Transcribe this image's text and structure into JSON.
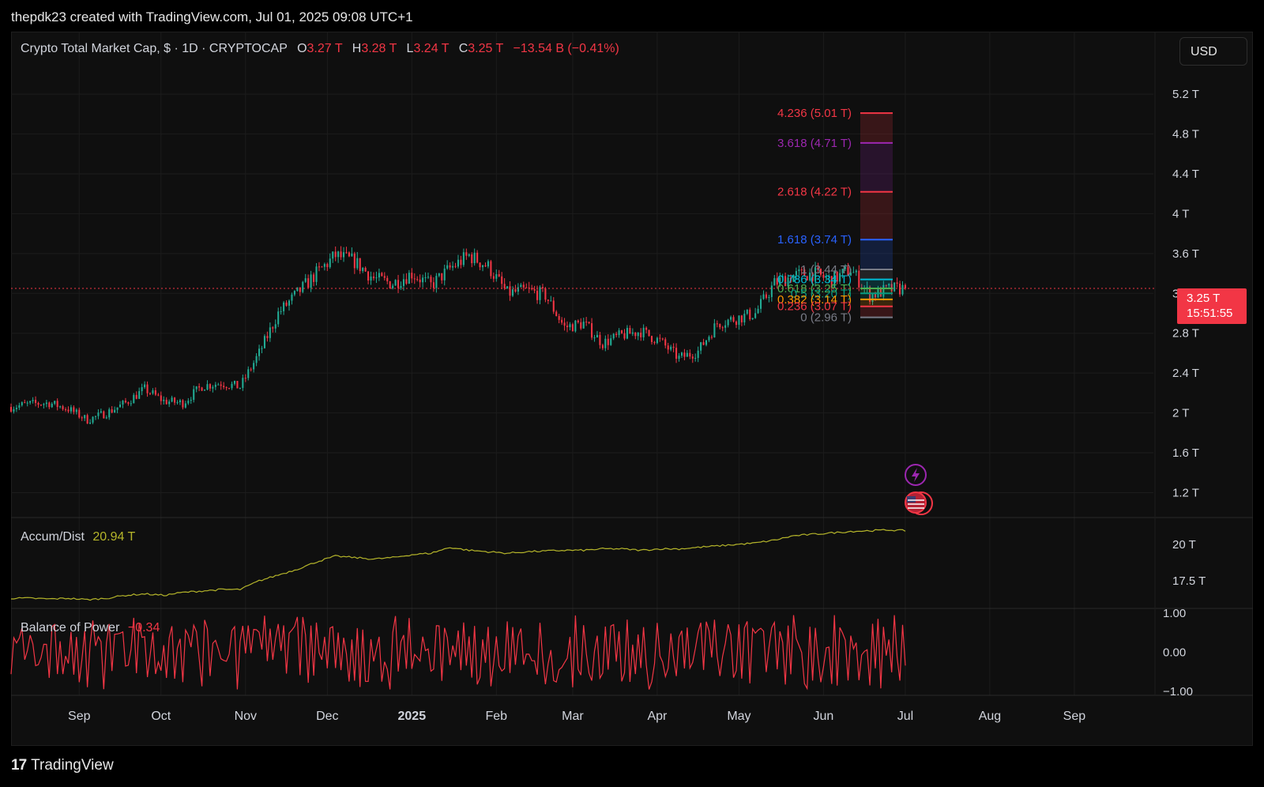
{
  "header": {
    "creator_line": "thepdk23 created with TradingView.com, Jul 01, 2025 09:08 UTC+1"
  },
  "toolbar": {
    "currency_button": "USD"
  },
  "symbol_legend": {
    "name": "Crypto Total Market Cap, $ · 1D · CRYPTOCAP",
    "open_key": "O",
    "open": "3.27 T",
    "high_key": "H",
    "high": "3.28 T",
    "low_key": "L",
    "low": "3.24 T",
    "close_key": "C",
    "close": "3.25 T",
    "change": "−13.54 B (−0.41%)"
  },
  "last_price": {
    "value": "3.25 T",
    "countdown": "15:51:55"
  },
  "indicators": {
    "ad_name": "Accum/Dist",
    "ad_value": "20.94 T",
    "bop_name": "Balance of Power",
    "bop_value": "−0.34"
  },
  "brand": {
    "logo": "17",
    "name": "TradingView"
  },
  "colors": {
    "up": "#22ab94",
    "down": "#f23645",
    "ad_line": "#b5b52a",
    "bop_line": "#f23645",
    "background": "#0f0f0f",
    "grid": "#1c1c1c"
  },
  "chart_data": {
    "type": "candlestick",
    "timeframe": "1D",
    "symbol": "CRYPTOCAP:TOTAL",
    "x_ticks": [
      "Sep",
      "Oct",
      "Nov",
      "Dec",
      "2025",
      "Feb",
      "Mar",
      "Apr",
      "May",
      "Jun",
      "Jul",
      "Aug",
      "Sep"
    ],
    "y_ticks": [
      "5.2 T",
      "4.8 T",
      "4.4 T",
      "4 T",
      "3.6 T",
      "3.2 T",
      "2.8 T",
      "2.4 T",
      "2 T",
      "1.6 T",
      "1.2 T"
    ],
    "y_tick_values": [
      5.2,
      4.8,
      4.4,
      4.0,
      3.6,
      3.2,
      2.8,
      2.4,
      2.0,
      1.6,
      1.2
    ],
    "ylim": [
      0.95,
      5.55
    ],
    "x_range": [
      "2024-08-07",
      "2025-09-30"
    ],
    "price_closes_weekly": [
      {
        "date": "2024-08-07",
        "close": 2.06
      },
      {
        "date": "2024-08-14",
        "close": 2.09
      },
      {
        "date": "2024-08-21",
        "close": 2.1
      },
      {
        "date": "2024-08-28",
        "close": 2.04
      },
      {
        "date": "2024-09-04",
        "close": 1.93
      },
      {
        "date": "2024-09-11",
        "close": 2.0
      },
      {
        "date": "2024-09-18",
        "close": 2.1
      },
      {
        "date": "2024-09-25",
        "close": 2.24
      },
      {
        "date": "2024-10-02",
        "close": 2.12
      },
      {
        "date": "2024-10-09",
        "close": 2.1
      },
      {
        "date": "2024-10-16",
        "close": 2.27
      },
      {
        "date": "2024-10-23",
        "close": 2.3
      },
      {
        "date": "2024-10-30",
        "close": 2.26
      },
      {
        "date": "2024-11-06",
        "close": 2.6
      },
      {
        "date": "2024-11-13",
        "close": 3.0
      },
      {
        "date": "2024-11-20",
        "close": 3.2
      },
      {
        "date": "2024-11-27",
        "close": 3.4
      },
      {
        "date": "2024-12-04",
        "close": 3.58
      },
      {
        "date": "2024-12-11",
        "close": 3.52
      },
      {
        "date": "2024-12-18",
        "close": 3.35
      },
      {
        "date": "2024-12-25",
        "close": 3.3
      },
      {
        "date": "2025-01-01",
        "close": 3.4
      },
      {
        "date": "2025-01-08",
        "close": 3.28
      },
      {
        "date": "2025-01-15",
        "close": 3.45
      },
      {
        "date": "2025-01-22",
        "close": 3.58
      },
      {
        "date": "2025-01-29",
        "close": 3.47
      },
      {
        "date": "2025-02-05",
        "close": 3.2
      },
      {
        "date": "2025-02-12",
        "close": 3.23
      },
      {
        "date": "2025-02-19",
        "close": 3.18
      },
      {
        "date": "2025-02-26",
        "close": 2.86
      },
      {
        "date": "2025-03-05",
        "close": 2.9
      },
      {
        "date": "2025-03-12",
        "close": 2.7
      },
      {
        "date": "2025-03-19",
        "close": 2.78
      },
      {
        "date": "2025-03-26",
        "close": 2.82
      },
      {
        "date": "2025-04-02",
        "close": 2.72
      },
      {
        "date": "2025-04-09",
        "close": 2.55
      },
      {
        "date": "2025-04-16",
        "close": 2.62
      },
      {
        "date": "2025-04-23",
        "close": 2.9
      },
      {
        "date": "2025-04-30",
        "close": 2.95
      },
      {
        "date": "2025-05-07",
        "close": 3.0
      },
      {
        "date": "2025-05-14",
        "close": 3.3
      },
      {
        "date": "2025-05-21",
        "close": 3.38
      },
      {
        "date": "2025-05-28",
        "close": 3.4
      },
      {
        "date": "2025-06-04",
        "close": 3.33
      },
      {
        "date": "2025-06-11",
        "close": 3.44
      },
      {
        "date": "2025-06-18",
        "close": 3.18
      },
      {
        "date": "2025-06-25",
        "close": 3.24
      },
      {
        "date": "2025-07-01",
        "close": 3.25
      }
    ],
    "last_close": 3.25,
    "fibonacci_extension": {
      "levels": [
        {
          "ratio": "4.236",
          "label": "4.236 (5.01 T)",
          "price": 5.01,
          "color": "#f23645"
        },
        {
          "ratio": "3.618",
          "label": "3.618 (4.71 T)",
          "price": 4.71,
          "color": "#9c27b0"
        },
        {
          "ratio": "2.618",
          "label": "2.618 (4.22 T)",
          "price": 4.22,
          "color": "#f23645"
        },
        {
          "ratio": "1.618",
          "label": "1.618 (3.74 T)",
          "price": 3.74,
          "color": "#2962ff"
        },
        {
          "ratio": "1",
          "label": "1 (3.44 T)",
          "price": 3.44,
          "color": "#787b86"
        },
        {
          "ratio": "0.786",
          "label": "0.786 (3.34 T)",
          "price": 3.34,
          "color": "#00bcd4"
        },
        {
          "ratio": "0.618",
          "label": "0.618 (3.25 T)",
          "price": 3.25,
          "color": "#4caf50"
        },
        {
          "ratio": "0.5",
          "label": "0.5 (3.20 T)",
          "price": 3.2,
          "color": "#089981"
        },
        {
          "ratio": "0.382",
          "label": "0.382 (3.14 T)",
          "price": 3.14,
          "color": "#ff9800"
        },
        {
          "ratio": "0.236",
          "label": "0.236 (3.07 T)",
          "price": 3.07,
          "color": "#f23645"
        },
        {
          "ratio": "0",
          "label": "0 (2.96 T)",
          "price": 2.96,
          "color": "#787b86"
        }
      ]
    },
    "accum_dist": {
      "y_ticks": [
        "20 T",
        "17.5 T"
      ],
      "y_tick_values": [
        20.0,
        17.5
      ],
      "ylim": [
        15.6,
        21.8
      ],
      "current": 20.94,
      "weekly": [
        16.3,
        16.3,
        16.25,
        16.3,
        16.2,
        16.3,
        16.5,
        16.6,
        16.5,
        16.7,
        16.8,
        16.9,
        16.9,
        17.5,
        17.9,
        18.3,
        18.8,
        19.2,
        19.1,
        19.0,
        19.1,
        19.3,
        19.4,
        19.8,
        19.6,
        19.5,
        19.4,
        19.5,
        19.55,
        19.6,
        19.6,
        19.7,
        19.7,
        19.6,
        19.7,
        19.7,
        19.8,
        19.9,
        20.0,
        20.1,
        20.3,
        20.6,
        20.7,
        20.8,
        20.9,
        20.95,
        21.0,
        20.94
      ]
    },
    "balance_of_power": {
      "y_ticks": [
        "1.00",
        "0.00",
        "−1.00"
      ],
      "y_tick_values": [
        1.0,
        0.0,
        -1.0
      ],
      "ylim": [
        -1.0,
        1.0
      ],
      "current": -0.34
    }
  }
}
